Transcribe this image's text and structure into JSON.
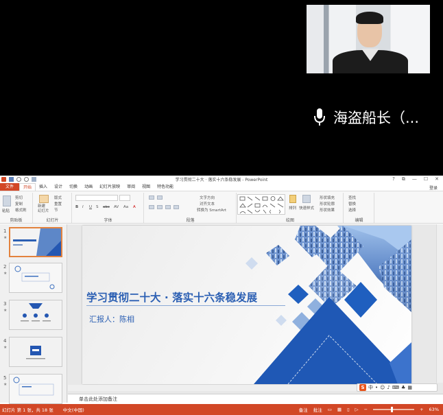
{
  "video": {
    "participant_name": "海盗船长（..."
  },
  "window": {
    "title": "学习贯彻二十大 · 落实十六条稳发展 - PowerPoint",
    "controls": [
      "?",
      "⧉",
      "—",
      "☐",
      "✕"
    ],
    "login": "登录"
  },
  "ribbon_tabs": {
    "file": "文件",
    "tabs": [
      "开始",
      "插入",
      "设计",
      "切换",
      "动画",
      "幻灯片放映",
      "审阅",
      "视图",
      "特色功能"
    ],
    "active_index": 0
  },
  "ribbon": {
    "clipboard": {
      "paste": "粘贴",
      "cut": "剪切",
      "copy": "复制",
      "format_painter": "格式刷",
      "label": "剪贴板"
    },
    "slides": {
      "new_slide": "新建\n幻灯片",
      "layout": "版式",
      "reset": "重置",
      "section": "节",
      "label": "幻灯片"
    },
    "font": {
      "label": "字体",
      "buttons": [
        "B",
        "I",
        "U",
        "S",
        "abc",
        "AV",
        "Aa",
        "A"
      ]
    },
    "paragraph": {
      "label": "段落",
      "text_direction": "文字方向",
      "align_text": "对齐文本",
      "smartart": "转换为 SmartArt"
    },
    "drawing": {
      "label": "绘图",
      "arrange": "排列",
      "quick_styles": "快速样式",
      "shape_fill": "形状填充",
      "shape_outline": "形状轮廓",
      "shape_effects": "形状效果"
    },
    "editing": {
      "label": "编辑",
      "find": "查找",
      "replace": "替换",
      "select": "选择"
    }
  },
  "thumbnails": [
    {
      "num": "1",
      "selected": true
    },
    {
      "num": "2",
      "selected": false
    },
    {
      "num": "3",
      "selected": false
    },
    {
      "num": "4",
      "selected": false
    },
    {
      "num": "5",
      "selected": false
    }
  ],
  "slide": {
    "title": "学习贯彻二十大 · 落实十六条稳发展",
    "reporter": "汇报人：陈相"
  },
  "notes": {
    "placeholder": "单击此处添加备注"
  },
  "ime": {
    "logo": "S",
    "mode": "中"
  },
  "status": {
    "slide_info": "幻灯片 第 1 张，共 18 张",
    "language": "中文(中国)",
    "notes": "备注",
    "comments": "批注",
    "zoom": "63%"
  },
  "colors": {
    "accent": "#d24726",
    "slide_blue": "#2b5fb3",
    "diamond_blue": "#1f5fbf"
  }
}
